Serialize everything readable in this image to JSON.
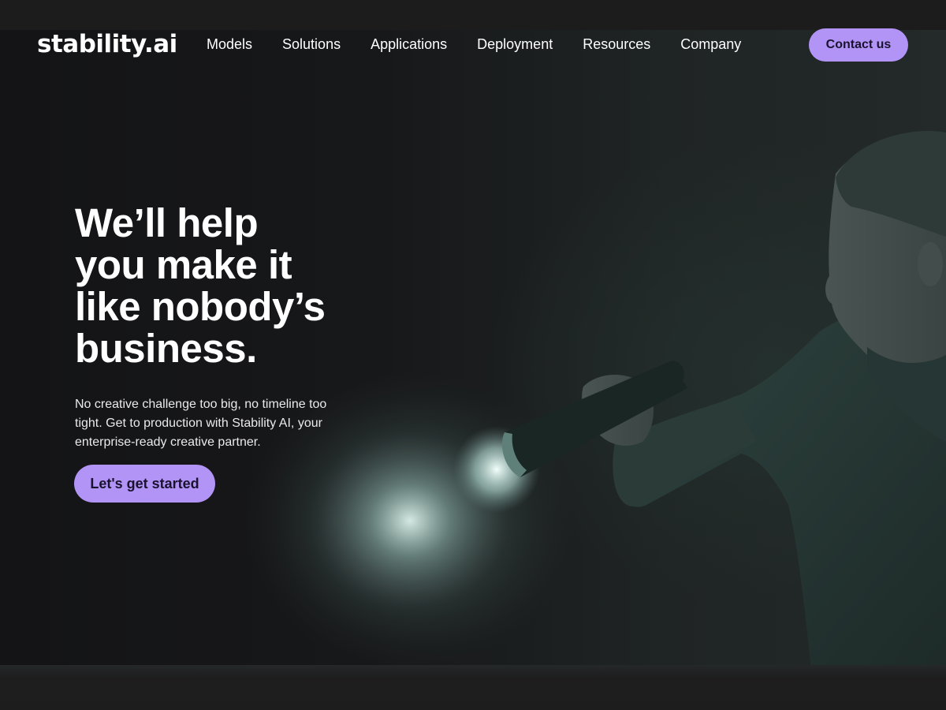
{
  "brand": {
    "logo_text": "stability.ai"
  },
  "nav": {
    "items": [
      {
        "label": "Models"
      },
      {
        "label": "Solutions"
      },
      {
        "label": "Applications"
      },
      {
        "label": "Deployment"
      },
      {
        "label": "Resources"
      },
      {
        "label": "Company"
      }
    ],
    "contact_label": "Contact us"
  },
  "hero": {
    "headline_lines": [
      "We’ll help",
      "you make it",
      "like nobody’s",
      "business."
    ],
    "subtext": "No creative challenge too big, no timeline too tight. Get to production with Stability AI, your enterprise-ready creative partner.",
    "cta_label": "Let's get started",
    "image_icon": "person-holding-flashlight-illustration"
  },
  "colors": {
    "accent": "#b294f7",
    "accent_text": "#1a1330",
    "background": "#1a1a1b",
    "text": "#ffffff"
  }
}
